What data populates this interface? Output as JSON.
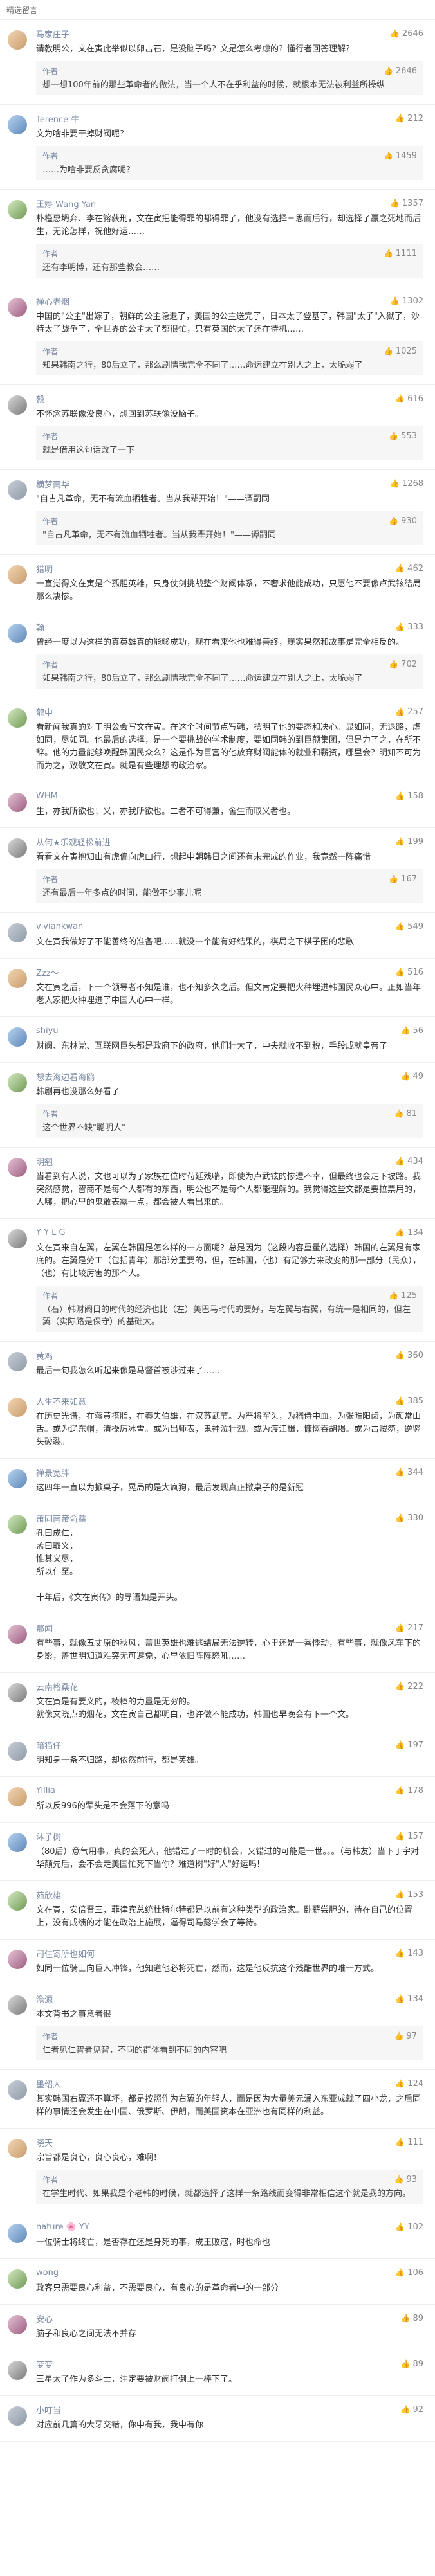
{
  "header": {
    "title": "精选留言"
  },
  "comments": [
    {
      "name": "马家庄子",
      "likes": "2646",
      "text": "请教明公，文在寅此举似以卵击石，是没脑子吗？文是怎么考虑的？懂行者回答理解？",
      "reply": {
        "name": "作者",
        "likes": "2646",
        "text": "想一想100年前的那些革命者的做法，当一个人不在乎利益的时候，就根本无法被利益所操纵"
      }
    },
    {
      "name": "Terence 牛",
      "likes": "212",
      "text": "文为啥非要干掉财阀呢？",
      "reply": {
        "name": "作者",
        "likes": "1459",
        "text": "……为啥非要反贪腐呢？"
      }
    },
    {
      "name": "王婷 Wang Yan",
      "likes": "1357",
      "text": "朴槿惠坍弃、李在镕获刑，文在寅把能得罪的都得罪了，他没有选择三思而后行，却选择了赢之死地而后生，无论怎样，祝他好运……",
      "reply": {
        "name": "作者",
        "likes": "1111",
        "text": "还有李明博，还有那些教会……"
      }
    },
    {
      "name": "禅心老烟",
      "likes": "1302",
      "text": "中国的\"公主\"出嫁了，朝鲜的公主隐退了，美国的公主送完了，日本太子登基了，韩国\"太子\"入狱了，沙特太子战争了，全世界的公主太子都很忙，只有英国的太子还在待机……",
      "reply": {
        "name": "作者",
        "likes": "1025",
        "text": "知果韩南之行，80后立了，那么剧情我完全不同了……命运建立在别人之上，太脆弱了"
      }
    },
    {
      "name": "毅",
      "likes": "616",
      "text": "不怀念苏联像没良心，想回到苏联像没脑子。",
      "reply": {
        "name": "作者",
        "likes": "553",
        "text": "就是借用这句话改了一下"
      }
    },
    {
      "name": "横梦南华",
      "likes": "1268",
      "text": "\"自古凡革命，无不有流血牺牲者。当从我辈开始！\"——谭嗣同",
      "reply": {
        "name": "作者",
        "likes": "930",
        "text": "\"自古凡革命，无不有流血牺牲者。当从我辈开始！\"——谭嗣同"
      }
    },
    {
      "name": "猎明",
      "likes": "462",
      "text": "一直觉得文在寅是个孤胆英雄，只身仗剑挑战整个财阀体系，不奢求他能成功，只愿他不要像卢武铉结局那么凄惨。",
      "reply": null
    },
    {
      "name": "翰",
      "likes": "333",
      "text": "曾经一度以为这样的真英雄真的能够成功，现在看来他也难得善终，现实果然和故事是完全相反的。",
      "reply": {
        "name": "作者",
        "likes": "702",
        "text": "如果韩南之行，80后立了，那么剧情我完全不同了……命运建立在别人之上，太脆弱了"
      }
    },
    {
      "name": "龍中",
      "likes": "257",
      "text": "看新闻我真的对于明公会写文在寅。在这个时间节点写韩，摆明了他的要态和决心。显如同，无退路，虚如同，尽如同。他最后的选择，是一个要挑战的学术制度，要如同韩的到巨额集团，但是力了之，在所不辞。他的力量能够唤醒韩国民众么？这是作为巨富的他放弃财阀能体的就业和薪资，哪里会？明知不可为而为之，致敬文在寅。就是有些理想的政治家。",
      "reply": null
    },
    {
      "name": "WHM",
      "likes": "158",
      "text": "生，亦我所欲也；义，亦我所欲也。二者不可得兼，舍生而取义者也。",
      "reply": null
    },
    {
      "name": "从何★乐观轻松前进",
      "likes": "199",
      "text": "看看文在寅抱知山有虎偏向虎山行，想起中朝韩日之间还有未完成的作业，我竟然一阵痛惜",
      "reply": {
        "name": "作者",
        "likes": "167",
        "text": "还有最后一年多点的时间，能做不少事儿呢"
      }
    },
    {
      "name": "viviankwan",
      "likes": "549",
      "text": "文在寅我做好了不能善终的准备吧……就没一个能有好结果的，棋局之下棋子困的悲歌",
      "reply": null
    },
    {
      "name": "Zzz～",
      "likes": "516",
      "text": "文在寅之后，下一个领导者不知是谁，也不知多久之后。但文肯定要把火种埋进韩国民众心中。正如当年老人家把火种埋进了中国人心中一样。",
      "reply": null
    },
    {
      "name": "shiyu",
      "likes": "56",
      "text": "财阀、东林党、互联网巨头都是政府下的政府，他们壮大了，中央就收不到税，手段成就皇帝了",
      "reply": null
    },
    {
      "name": "想去海边看海鸥",
      "likes": "49",
      "text": "韩剧再也没那么好看了",
      "reply": {
        "name": "作者",
        "likes": "81",
        "text": "这个世界不缺\"聪明人\""
      }
    },
    {
      "name": "明翘",
      "likes": "434",
      "text": "当看到有人说，文也可以为了家族在位时苟延残喘，即使为卢武铉的惨遭不幸，但最终也会走下坡路。我突然感觉，智商不是每个人都有的东西，明公也不是每个人都能理解的。我觉得这些文都是要拉票用的，人哪，把心里的鬼敢表露一点，都会被人看出来的。",
      "reply": null
    },
    {
      "name": "Y Y L G",
      "likes": "134",
      "text": "文在寅来自左翼，左翼在韩国是怎么样的一方面呢？总是因为（这段内容重量的选择）韩国的左翼是有家底的。左翼是劳工（包括青年）那部分重要的，但，在韩国，（也）有足够力来改变的那一部分（民众），（也）有比较厉害的那个人。",
      "reply": {
        "name": "作者",
        "likes": "125",
        "text": "（石）韩财阀目的时代的经济也比（左）美巴马时代的要好，与左翼与右翼，有统一是相同的，但左翼（实际路是保守）的基础大。"
      }
    },
    {
      "name": "黄鸡",
      "likes": "360",
      "text": "最后一句我怎么听起来像是马督首被涉过来了……",
      "reply": null
    },
    {
      "name": "人生不来如意",
      "likes": "385",
      "text": "在历史光谱，在蒋黄搭脂，在秦失伯雄，在汉苏武节。为严将军头，为嵇侍中血，为张睢阳齿，为颜常山舌。或为辽东帽，清操厉冰雪。或为出师表，鬼神泣壮烈。或为渡江楫，慷慨吞胡羯。或为击贼笏，逆竖头破裂。",
      "reply": null
    },
    {
      "name": "禅景宽胖",
      "likes": "344",
      "text": "这四年一直以为掀桌子，晃局的是大疯狗，最后发现真正掀桌子的是新冠",
      "reply": null
    },
    {
      "name": "萧同南帝俞鑫",
      "likes": "330",
      "text": "孔曰成仁，\n孟曰取义，\n惟其义尽，\n所以仁至。\n\n十年后，《文在寅传》的导语如是开头。",
      "reply": null
    },
    {
      "name": "那闻",
      "likes": "217",
      "text": "有些事，就像五丈原的秋风，盖世英雄也难逃结局无法逆转，心里还是一番悸动，有些事，就像风车下的身影，盖世明知道难突无可避免，心里依旧阵阵怒吼……",
      "reply": null
    },
    {
      "name": "云南格桑花",
      "likes": "222",
      "text": "文在寅是有要义的，棱棒的力量是无穷的。\n就像文晓点的烟花，文在寅自己都明白，也许做不能成功，韩国也早晚会有下一个文。",
      "reply": null
    },
    {
      "name": "暗猫仔",
      "likes": "197",
      "text": "明知身一条不归路，却依然前行，都是英雄。",
      "reply": null
    },
    {
      "name": "Yillia",
      "likes": "178",
      "text": "所以反996的荤头是不会落下的意吗",
      "reply": null
    },
    {
      "name": "沐子树",
      "likes": "157",
      "text": "（80后）意气用事，真的会死人，他错过了一时的机会，又错过的可能是一世。。。（与韩友）当下丁宇对华颠先后，会不会走美国忙死下当你？难道树\"好\"人\"好运吗!",
      "reply": null
    },
    {
      "name": "茹欣雄",
      "likes": "153",
      "text": "文在寅，安倍晋三，菲律宾总统杜特尔特都是以前有这种类型的政治家。卧薪尝胆的，待在自己的位置上，没有成绩的才能在政治上施展，逼得司马懿学会了等待。",
      "reply": null
    },
    {
      "name": "司住寄所也如何",
      "likes": "143",
      "text": "如同一位骑士向巨人冲锋，他知道他必将死亡，然而，这是他反抗这个残酷世界的唯一方式。",
      "reply": null
    },
    {
      "name": "澹源",
      "likes": "134",
      "text": "本文背书之事意者很",
      "reply": {
        "name": "作者",
        "likes": "97",
        "text": "仁者见仁智者见智，不同的群体看到不同的内容吧"
      }
    },
    {
      "name": "墨绍人",
      "likes": "124",
      "text": "其实韩国右翼还不算坏，都是按照作为右翼的年轻人，而是因为大量美元涌入东亚成就了四小龙，之后同样的事情还会发生在中国、俄罗斯、伊朗，而美国资本在亚洲也有同样的利益。",
      "reply": null
    },
    {
      "name": "晓天",
      "likes": "111",
      "text": "宗旨都是良心，良心良心，难啊！",
      "reply": {
        "name": "作者",
        "likes": "93",
        "text": "在学生时代、如果我是个老韩的时候，就都选择了这样一条路线而变得非常相信这个就是我的方向。"
      }
    },
    {
      "name": "nature 🌸 YY",
      "likes": "102",
      "text": "一位骑士将终亡，是否存在还是身死的事，成王败寇，时也命也",
      "reply": null
    },
    {
      "name": "wong",
      "likes": "106",
      "text": "政客只需要良心利益，不需要良心，有良心的是革命者中的一部分",
      "reply": null
    },
    {
      "name": "安心",
      "likes": "89",
      "text": "脑子和良心之间无法不并存",
      "reply": null
    },
    {
      "name": "萝萝",
      "likes": "89",
      "text": "三星太子作为多斗士，注定要被财阀打倒上一棒下了。",
      "reply": null
    },
    {
      "name": "小叮当",
      "likes": "92",
      "text": "对应前几篇的大牙交错，你中有我，我中有你",
      "reply": null
    }
  ]
}
